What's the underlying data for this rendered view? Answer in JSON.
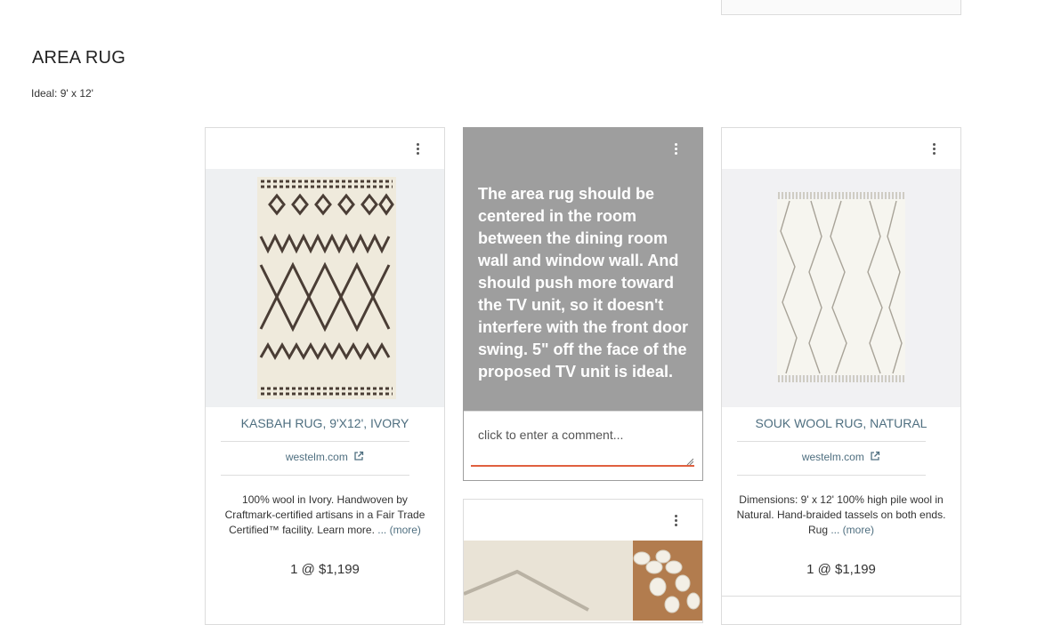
{
  "section": {
    "title": "AREA RUG",
    "subtitle": "Ideal: 9' x 12'"
  },
  "cards": {
    "kasbah": {
      "name": "KASBAH RUG, 9'X12', IVORY",
      "source": "westelm.com",
      "description": "100% wool in Ivory. Handwoven by Craftmark-certified artisans in a Fair Trade Certified™ facility. Learn more. ",
      "more": "... (more)",
      "price": "1 @ $1,199"
    },
    "note": {
      "text": "The area rug should be centered in the room between the dining room wall and window wall. And should push more toward the TV unit, so it doesn't interfere with the front door swing. 5\" off the face of the proposed TV unit is ideal.",
      "comment_placeholder": "click to enter a comment..."
    },
    "souk": {
      "name": "SOUK WOOL RUG, NATURAL",
      "source": "westelm.com",
      "description": "Dimensions: 9' x 12' 100% high pile wool in Natural. Hand-braided tassels on both ends. Rug ",
      "more": "... (more)",
      "price": "1 @ $1,199"
    }
  },
  "icons": {
    "menu": "more-vertical-icon",
    "external": "external-link-icon"
  },
  "colors": {
    "link": "#4f6f80",
    "note_bg": "#9e9e9e",
    "comment_underline": "#e0603f"
  }
}
